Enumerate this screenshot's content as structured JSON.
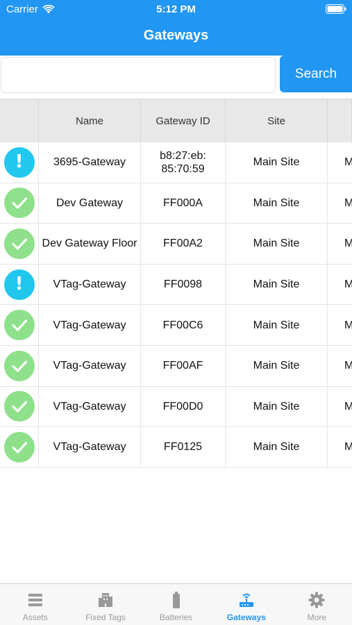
{
  "status_bar": {
    "carrier": "Carrier",
    "time": "5:12 PM"
  },
  "nav": {
    "title": "Gateways"
  },
  "search": {
    "placeholder": "",
    "button_label": "Search"
  },
  "table": {
    "columns": [
      "",
      "Name",
      "Gateway ID",
      "Site",
      ""
    ],
    "rows": [
      {
        "status": "warning",
        "name": "3695-Gateway",
        "gateway_id": "b8:27:eb:\n85:70:59",
        "site": "Main Site",
        "extra": "M"
      },
      {
        "status": "ok",
        "name": "Dev Gateway",
        "gateway_id": "FF000A",
        "site": "Main Site",
        "extra": "M"
      },
      {
        "status": "ok",
        "name": "Dev Gateway Floor",
        "gateway_id": "FF00A2",
        "site": "Main Site",
        "extra": "M"
      },
      {
        "status": "warning",
        "name": "VTag-Gateway",
        "gateway_id": "FF0098",
        "site": "Main Site",
        "extra": "M"
      },
      {
        "status": "ok",
        "name": "VTag-Gateway",
        "gateway_id": "FF00C6",
        "site": "Main Site",
        "extra": "M"
      },
      {
        "status": "ok",
        "name": "VTag-Gateway",
        "gateway_id": "FF00AF",
        "site": "Main Site",
        "extra": "M"
      },
      {
        "status": "ok",
        "name": "VTag-Gateway",
        "gateway_id": "FF00D0",
        "site": "Main Site",
        "extra": "M"
      },
      {
        "status": "ok",
        "name": "VTag-Gateway",
        "gateway_id": "FF0125",
        "site": "Main Site",
        "extra": "M"
      }
    ]
  },
  "tabbar": {
    "tabs": [
      {
        "label": "Assets",
        "icon": "list-icon",
        "active": false
      },
      {
        "label": "Fixed Tags",
        "icon": "building-icon",
        "active": false
      },
      {
        "label": "Batteries",
        "icon": "battery-icon",
        "active": false
      },
      {
        "label": "Gateways",
        "icon": "router-icon",
        "active": true
      },
      {
        "label": "More",
        "icon": "gear-icon",
        "active": false
      }
    ]
  },
  "colors": {
    "primary": "#2196f3",
    "ok_status": "#8ee18a",
    "warning_status": "#22c7ee",
    "inactive_tab": "#999999"
  }
}
